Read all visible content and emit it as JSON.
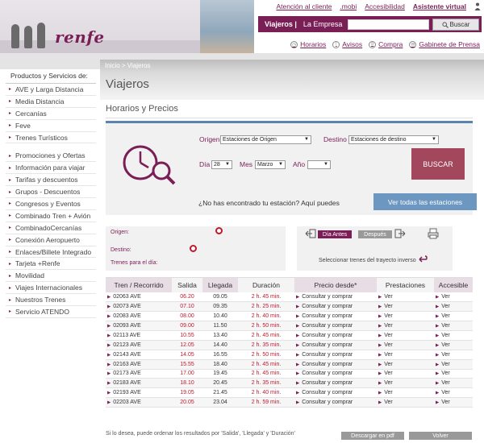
{
  "brand": {
    "logo": "renfe",
    "accent": "#7a1e56",
    "blue": "#5a84ad",
    "button_red": "#a3475d"
  },
  "top_links": [
    "Atención al cliente",
    ".mobi",
    "Accesibilidad",
    "Asistente virtual"
  ],
  "header_bar": {
    "viajeros": "Viajeros |",
    "empresa": "La Empresa",
    "search_placeholder": "",
    "search_button": "Buscar"
  },
  "sub_links": [
    "Horarios",
    "Avisos",
    "Compra",
    "Gabinete de Prensa"
  ],
  "breadcrumb": "Inicio > Viajeros",
  "page_title": "Viajeros",
  "section_title": "Horarios y Precios",
  "sidebar": {
    "title": "Productos y Servicios de:",
    "group1": [
      "AVE y Larga Distancia",
      "Media Distancia",
      "Cercanías",
      "Feve",
      "Trenes Turísticos"
    ],
    "group2": [
      "Promociones y Ofertas",
      "Información para viajar",
      "Tarifas y descuentos",
      "Grupos - Descuentos",
      "Congresos y Eventos",
      "Combinado Tren + Avión",
      "CombinadoCercanías",
      "Conexión Aeropuerto",
      "Enlaces/Billete Integrado",
      "Tarjeta +Renfe",
      "Movilidad",
      "Viajes Internacionales",
      "Nuestros Trenes",
      "Servicio ATENDO"
    ]
  },
  "form": {
    "origen_label": "Origen",
    "origen_value": "Estaciones de Origen",
    "destino_label": "Destino",
    "destino_value": "Estaciones de destino",
    "dia_label": "Día",
    "dia_value": "28",
    "mes_label": "Mes",
    "mes_value": "Marzo",
    "anio_label": "Año",
    "anio_value": "",
    "buscar": "BUSCAR",
    "no_estacion": "¿No has encontrado tu estación? Aquí puedes",
    "ver_estaciones": "Ver todas las estaciones"
  },
  "info": {
    "origen": "Origen:",
    "destino": "Destino:",
    "trenes": "Trenes para el día:",
    "antes": "Día Antes",
    "despues": "Después",
    "inverso": "Seleccionar trenes del trayecto inverso"
  },
  "table": {
    "headers": [
      "Tren / Recorrido",
      "Salida",
      "Llegada",
      "Duración",
      "Precio desde*",
      "Prestaciones",
      "Accesible"
    ],
    "rows": [
      [
        "02063 AVE",
        "06.20",
        "09.05",
        "2 h. 45 min.",
        "Consultar y comprar",
        "Ver",
        "Ver"
      ],
      [
        "02073 AVE",
        "07.10",
        "09.35",
        "2 h. 25 min.",
        "Consultar y comprar",
        "Ver",
        "Ver"
      ],
      [
        "02083 AVE",
        "08.00",
        "10.40",
        "2 h. 40 min.",
        "Consultar y comprar",
        "Ver",
        "Ver"
      ],
      [
        "02093 AVE",
        "09.00",
        "11.50",
        "2 h. 50 min.",
        "Consultar y comprar",
        "Ver",
        "Ver"
      ],
      [
        "02113 AVE",
        "10.55",
        "13.40",
        "2 h. 45 min.",
        "Consultar y comprar",
        "Ver",
        "Ver"
      ],
      [
        "02123 AVE",
        "12.05",
        "14.40",
        "2 h. 35 min.",
        "Consultar y comprar",
        "Ver",
        "Ver"
      ],
      [
        "02143 AVE",
        "14.05",
        "16.55",
        "2 h. 50 min.",
        "Consultar y comprar",
        "Ver",
        "Ver"
      ],
      [
        "02163 AVE",
        "15.55",
        "18.40",
        "2 h. 45 min.",
        "Consultar y comprar",
        "Ver",
        "Ver"
      ],
      [
        "02173 AVE",
        "17.00",
        "19.45",
        "2 h. 45 min.",
        "Consultar y comprar",
        "Ver",
        "Ver"
      ],
      [
        "02183 AVE",
        "18.10",
        "20.45",
        "2 h. 35 min.",
        "Consultar y comprar",
        "Ver",
        "Ver"
      ],
      [
        "02193 AVE",
        "19.05",
        "21.45",
        "2 h. 40 min.",
        "Consultar y comprar",
        "Ver",
        "Ver"
      ],
      [
        "02203 AVE",
        "20.05",
        "23.04",
        "2 h. 59 min.",
        "Consultar y comprar",
        "Ver",
        "Ver"
      ]
    ]
  },
  "footer": {
    "note": "Si lo desea, puede ordenar los resultados por 'Salida', 'Llegada' y 'Duración'",
    "pdf": "Descargar en pdf",
    "volver": "Volver"
  }
}
